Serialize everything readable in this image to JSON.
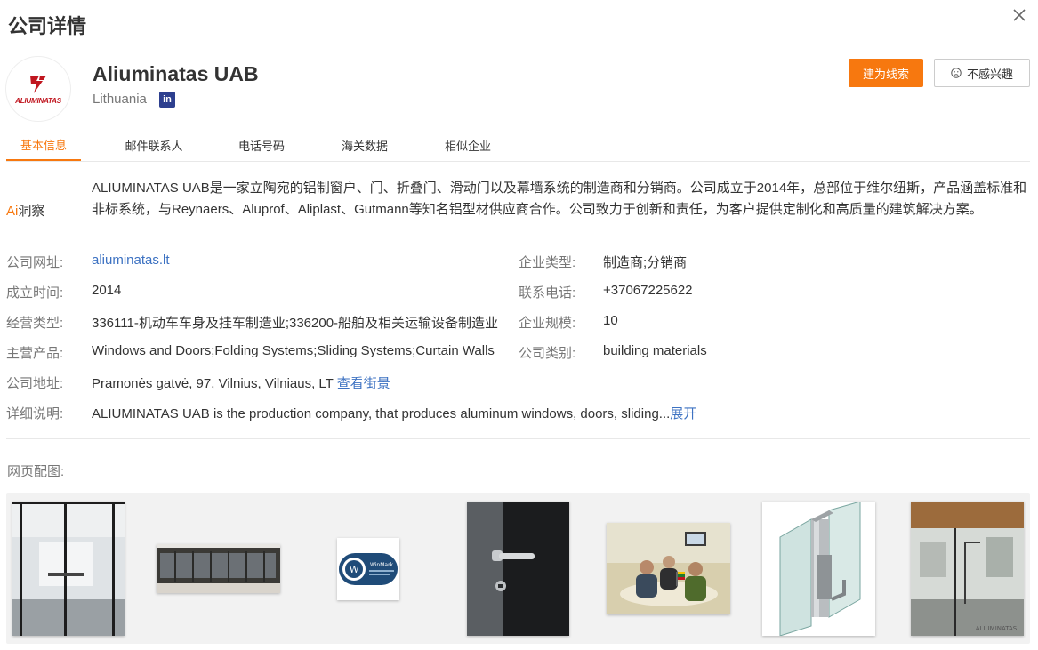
{
  "modal": {
    "title": "公司详情"
  },
  "company": {
    "logo_text": "ALIUMINATAS",
    "name": "Aliuminatas UAB",
    "country": "Lithuania",
    "linkedin_label": "in"
  },
  "actions": {
    "lead_label": "建为线索",
    "not_interested_label": "不感兴趣"
  },
  "tabs": [
    {
      "label": "基本信息",
      "active": true
    },
    {
      "label": "邮件联系人"
    },
    {
      "label": "电话号码"
    },
    {
      "label": "海关数据"
    },
    {
      "label": "相似企业"
    }
  ],
  "ai": {
    "prefix": "Ai",
    "label": "洞察",
    "text": "ALIUMINATAS UAB是一家立陶宛的铝制窗户、门、折叠门、滑动门以及幕墙系统的制造商和分销商。公司成立于2014年，总部位于维尔纽斯，产品涵盖标准和非标系统，与Reynaers、Aluprof、Aliplast、Gutmann等知名铝型材供应商合作。公司致力于创新和责任，为客户提供定制化和高质量的建筑解决方案。"
  },
  "details": {
    "website_label": "公司网址:",
    "website": "aliuminatas.lt",
    "company_type_label": "企业类型:",
    "company_type": "制造商;分销商",
    "founded_label": "成立时间:",
    "founded": "2014",
    "phone_label": "联系电话:",
    "phone": "+37067225622",
    "business_type_label": "经营类型:",
    "business_type": "336111-机动车车身及挂车制造业;336200-船舶及相关运输设备制造业",
    "size_label": "企业规模:",
    "size": "10",
    "products_label": "主营产品:",
    "products": "Windows and Doors;Folding Systems;Sliding Systems;Curtain Walls",
    "category_label": "公司类别:",
    "category": "building materials",
    "address_label": "公司地址:",
    "address": "Pramonės gatvė, 97, Vilnius, Vilniaus, LT",
    "street_view": "查看街景",
    "description_label": "详细说明:",
    "description": "ALIUMINATAS UAB is the production company, that produces aluminum windows, doors, sliding...",
    "expand": "展开"
  },
  "gallery": {
    "label": "网页配图:",
    "images": [
      {
        "icon": "glass-partition-office"
      },
      {
        "icon": "building-facade"
      },
      {
        "icon": "winmark-badge",
        "text": "WinMark"
      },
      {
        "icon": "door-handle"
      },
      {
        "icon": "meeting-room"
      },
      {
        "icon": "aluminum-profile"
      },
      {
        "icon": "glass-door-office",
        "text": "ALIUMINATAS"
      }
    ]
  },
  "colors": {
    "accent": "#f7780f",
    "link": "#3d72c2",
    "brand_red": "#c0161f",
    "linkedin": "#2d3f8f"
  }
}
